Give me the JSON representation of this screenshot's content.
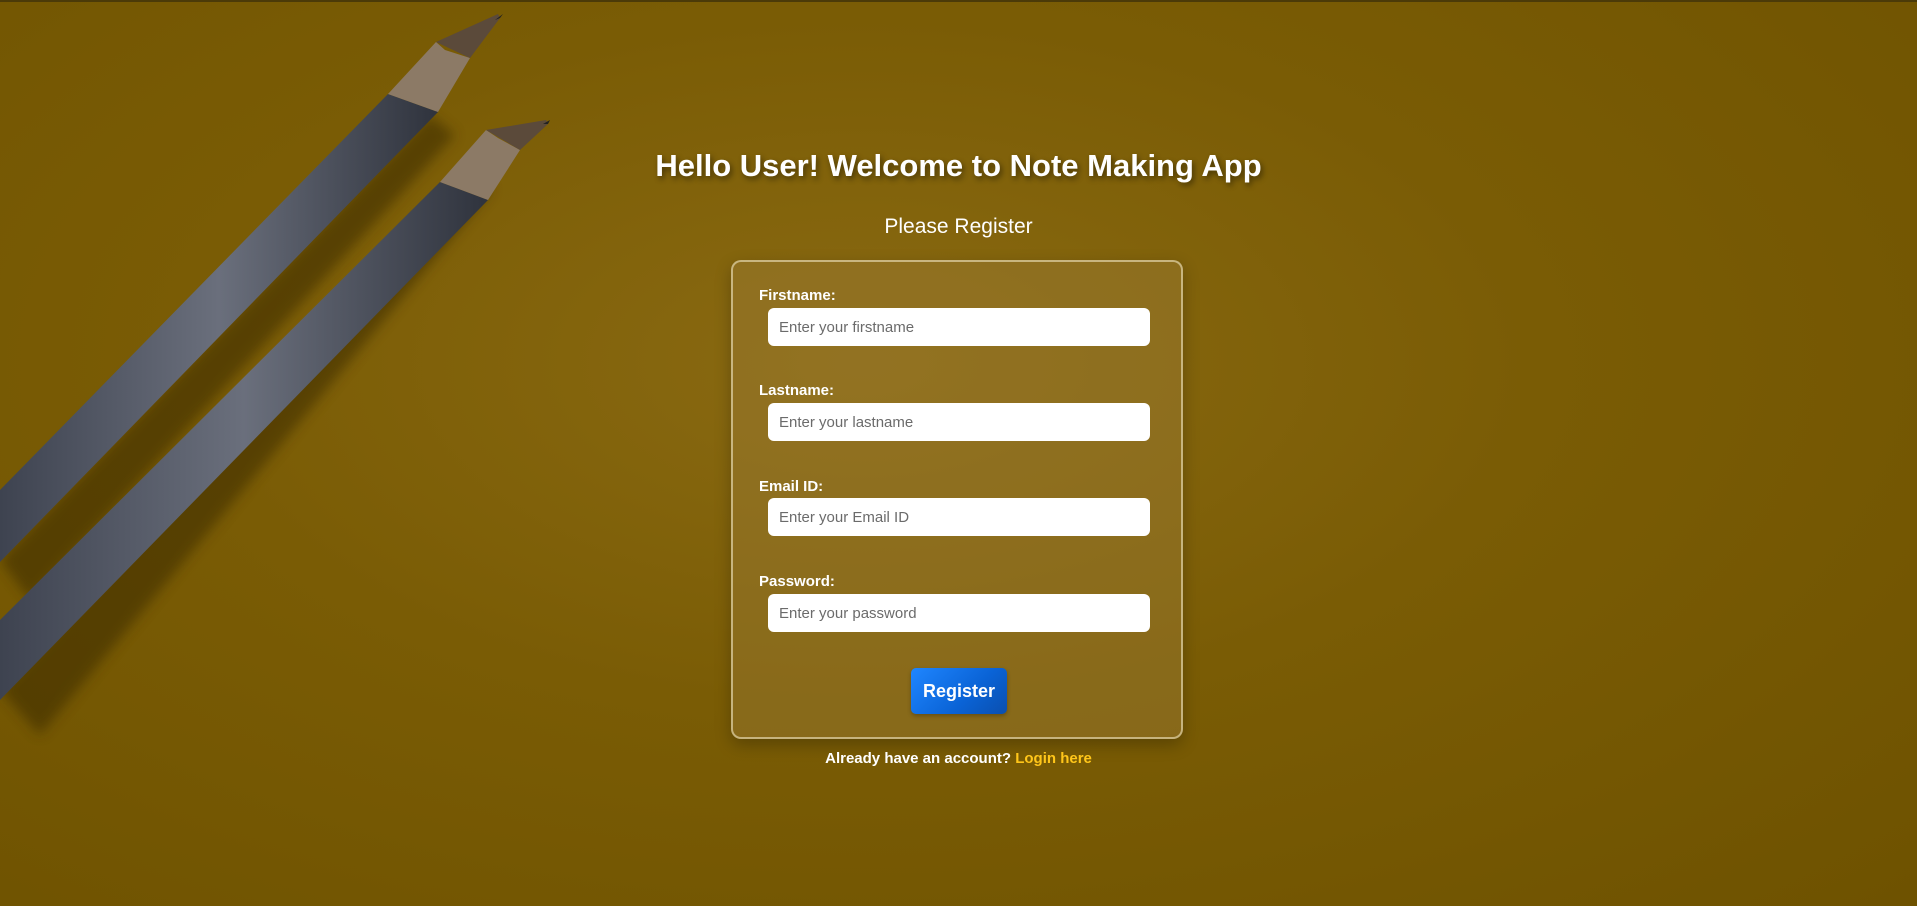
{
  "heading": "Hello User! Welcome to Note Making App",
  "subheading": "Please Register",
  "form": {
    "firstname": {
      "label": "Firstname:",
      "placeholder": "Enter your firstname",
      "value": ""
    },
    "lastname": {
      "label": "Lastname:",
      "placeholder": "Enter your lastname",
      "value": ""
    },
    "email": {
      "label": "Email ID:",
      "placeholder": "Enter your Email ID",
      "value": ""
    },
    "password": {
      "label": "Password:",
      "placeholder": "Enter your password",
      "value": ""
    },
    "submit_label": "Register"
  },
  "footer": {
    "prompt": "Already have an account?",
    "link_label": "Login here"
  },
  "colors": {
    "background": "#7a5c05",
    "button": "#0a63d6",
    "link": "#ffc61a"
  },
  "background_image": "pencils-on-yellow-desk"
}
